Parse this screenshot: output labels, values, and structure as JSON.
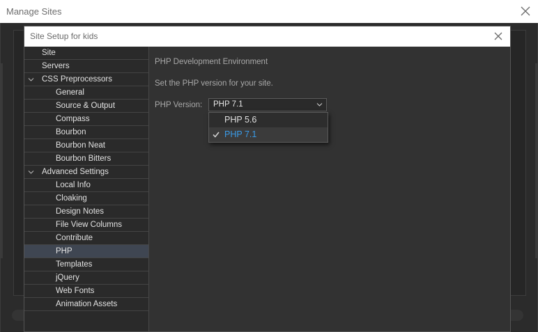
{
  "outer_window": {
    "title": "Manage Sites"
  },
  "dialog": {
    "title": "Site Setup for kids"
  },
  "sidebar": {
    "items": [
      {
        "label": "Site",
        "level": 0
      },
      {
        "label": "Servers",
        "level": 0
      },
      {
        "label": "CSS Preprocessors",
        "level": 0,
        "expanded": true
      },
      {
        "label": "General",
        "level": 1
      },
      {
        "label": "Source & Output",
        "level": 1
      },
      {
        "label": "Compass",
        "level": 1
      },
      {
        "label": "Bourbon",
        "level": 1
      },
      {
        "label": "Bourbon Neat",
        "level": 1
      },
      {
        "label": "Bourbon Bitters",
        "level": 1
      },
      {
        "label": "Advanced Settings",
        "level": 0,
        "expanded": true
      },
      {
        "label": "Local Info",
        "level": 1
      },
      {
        "label": "Cloaking",
        "level": 1
      },
      {
        "label": "Design Notes",
        "level": 1
      },
      {
        "label": "File View Columns",
        "level": 1
      },
      {
        "label": "Contribute",
        "level": 1
      },
      {
        "label": "PHP",
        "level": 1,
        "selected": true
      },
      {
        "label": "Templates",
        "level": 1
      },
      {
        "label": "jQuery",
        "level": 1
      },
      {
        "label": "Web Fonts",
        "level": 1
      },
      {
        "label": "Animation Assets",
        "level": 1
      }
    ]
  },
  "main": {
    "section_title": "PHP Development Environment",
    "description": "Set the PHP version for your site.",
    "php_version_label": "PHP Version:",
    "php_version_selected": "PHP 7.1",
    "dropdown_options": [
      {
        "label": "PHP 5.6",
        "checked": false
      },
      {
        "label": "PHP 7.1",
        "checked": true
      }
    ]
  },
  "colors": {
    "selected_row": "#3f4652",
    "accent_text": "#3a9be8",
    "background": "#323232"
  }
}
